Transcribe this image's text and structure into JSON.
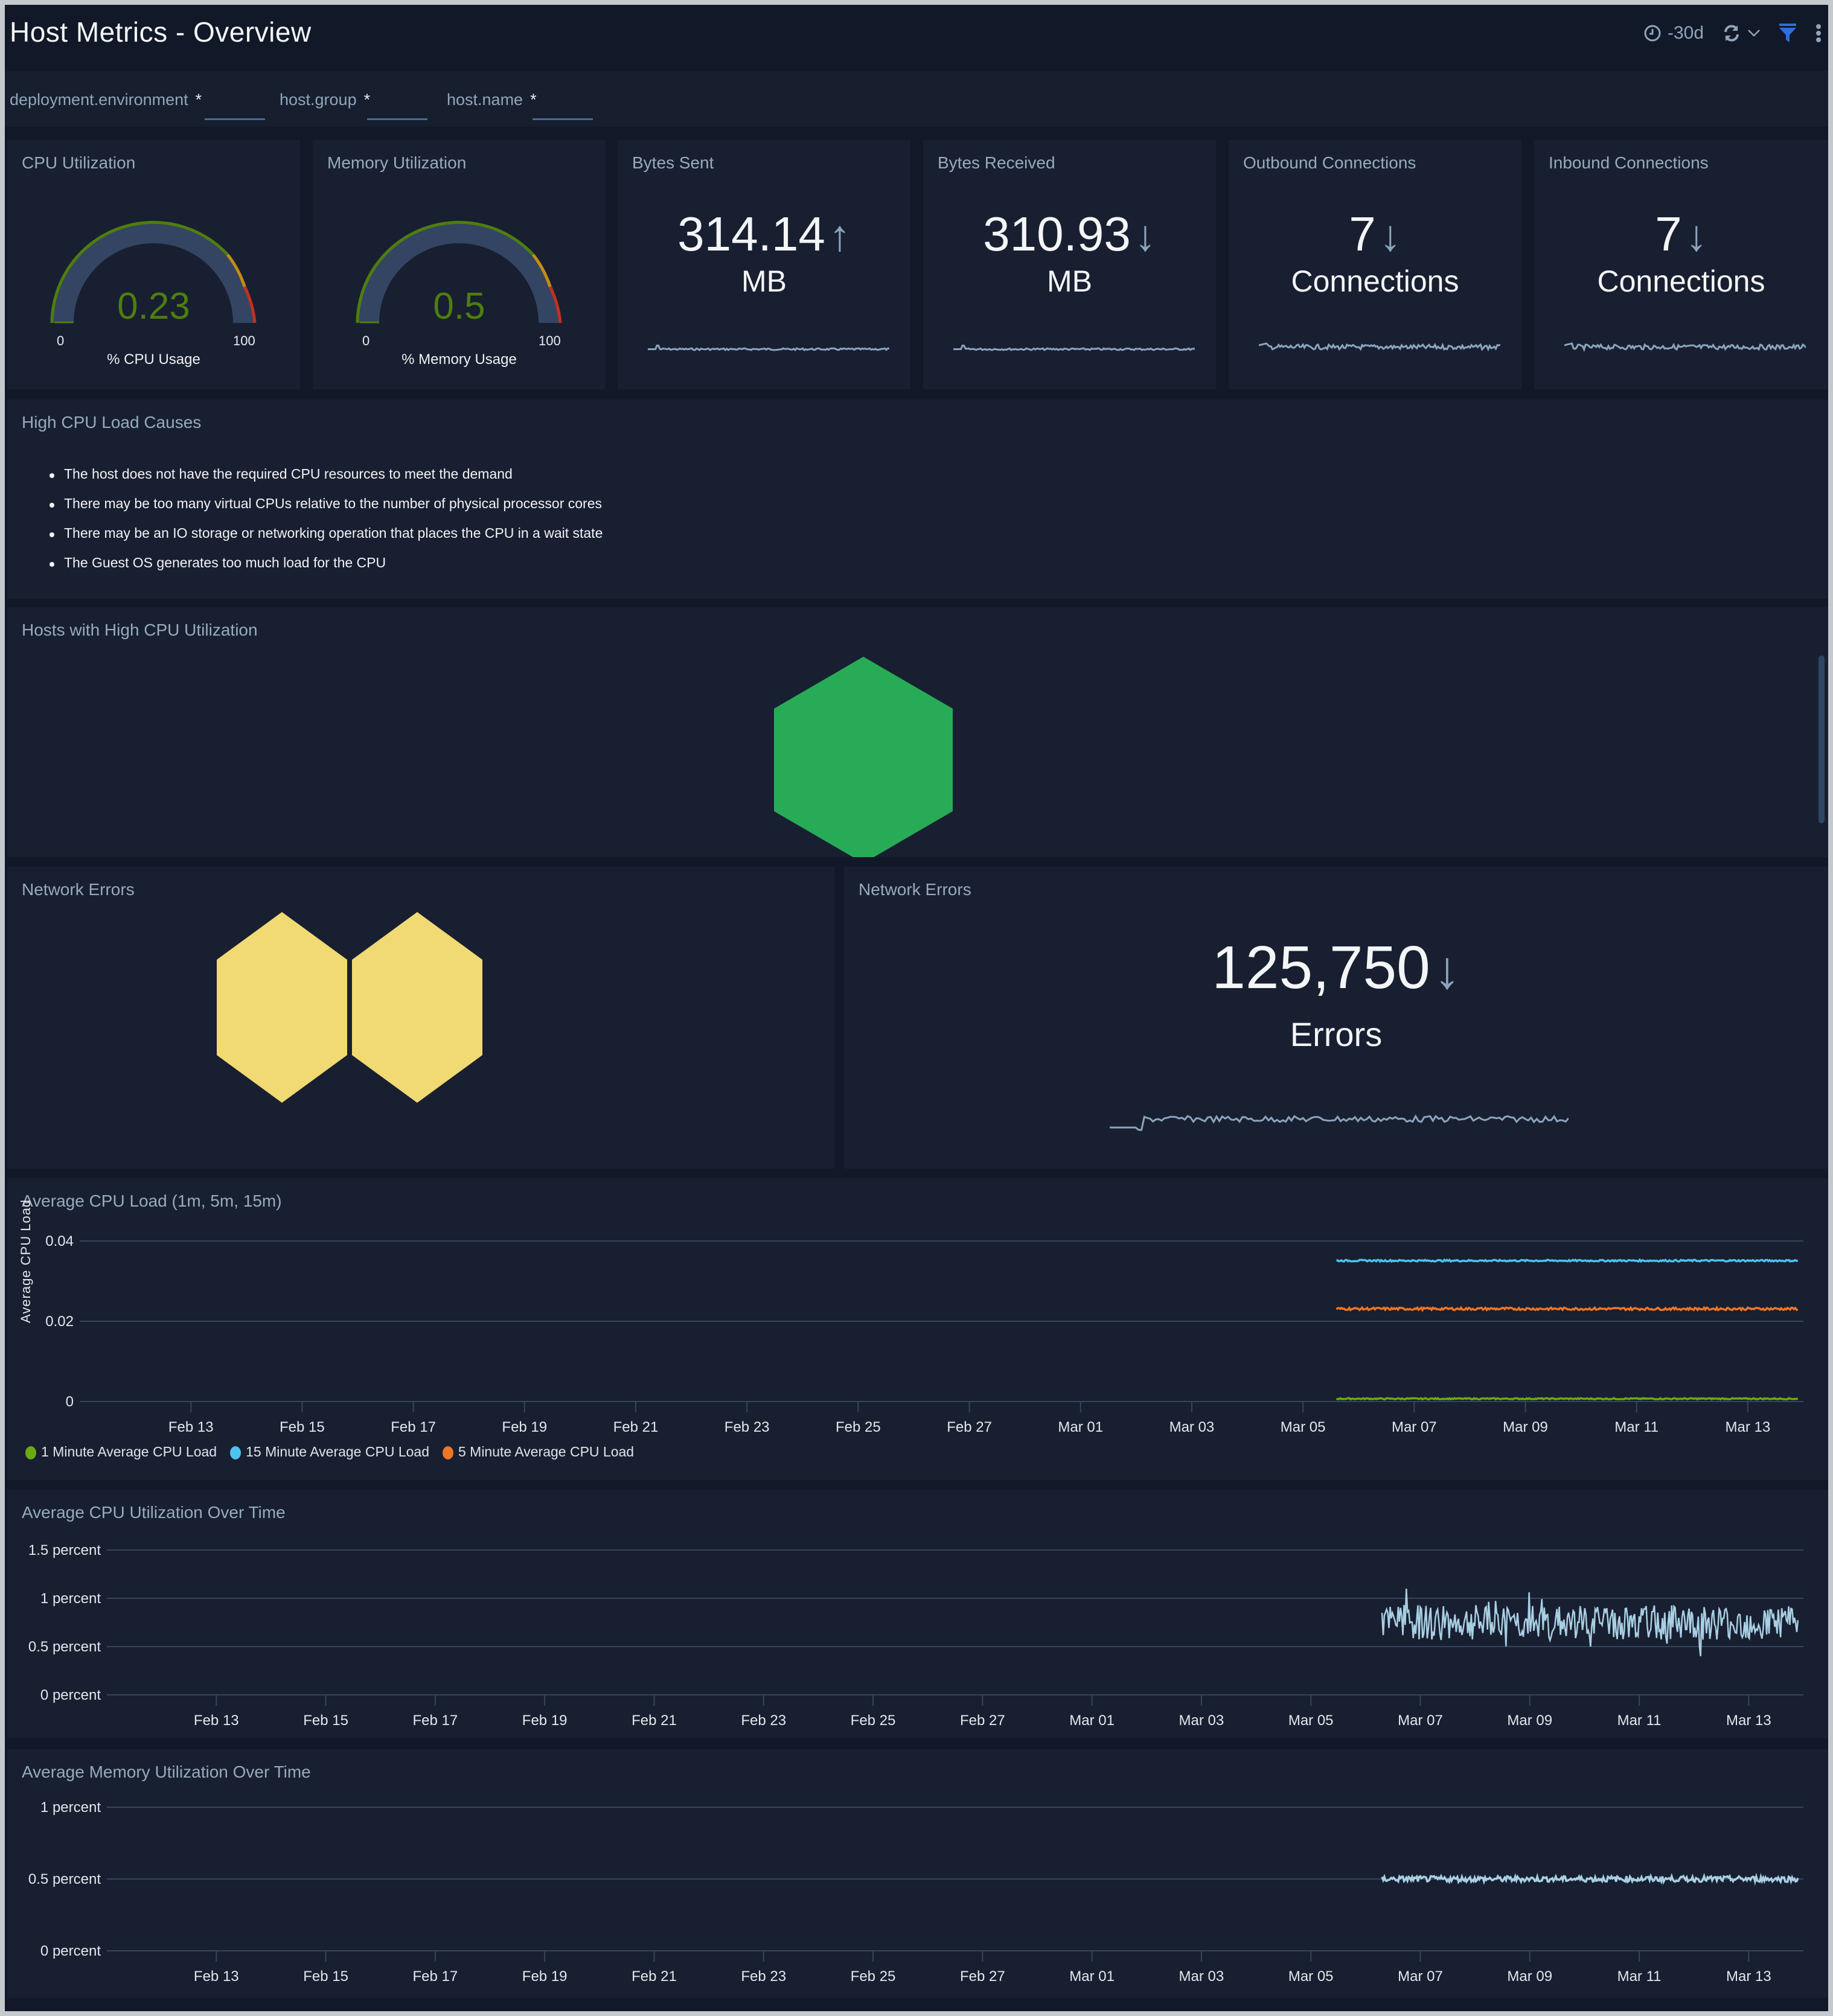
{
  "header": {
    "title": "Host Metrics - Overview",
    "time_range": "-30d",
    "icons": [
      "clock-icon",
      "refresh-icon",
      "chevron-down-icon",
      "filter-icon",
      "more-vertical-icon"
    ],
    "filter_icon_color": "#2e6fdb"
  },
  "filters": [
    {
      "label": "deployment.environment",
      "value": "*"
    },
    {
      "label": "host.group",
      "value": "*"
    },
    {
      "label": "host.name",
      "value": "*"
    }
  ],
  "gauges": [
    {
      "title": "CPU Utilization",
      "value": "0.23",
      "min": "0",
      "max": "100",
      "label": "% CPU Usage",
      "value_color": "#4e7d0e"
    },
    {
      "title": "Memory Utilization",
      "value": "0.5",
      "min": "0",
      "max": "100",
      "label": "% Memory Usage",
      "value_color": "#4e7d0e"
    }
  ],
  "stat_tiles": [
    {
      "title": "Bytes Sent",
      "value": "314.14",
      "trend": "up",
      "trend_glyph": "↑",
      "unit": "MB"
    },
    {
      "title": "Bytes Received",
      "value": "310.93",
      "trend": "down",
      "trend_glyph": "↓",
      "unit": "MB"
    },
    {
      "title": "Outbound Connections",
      "value": "7",
      "trend": "down",
      "trend_glyph": "↓",
      "unit": "Connections"
    },
    {
      "title": "Inbound Connections",
      "value": "7",
      "trend": "down",
      "trend_glyph": "↓",
      "unit": "Connections"
    }
  ],
  "causes": {
    "title": "High CPU Load Causes",
    "items": [
      "The host does not have the required CPU resources to meet the demand",
      "There may be too many virtual CPUs relative to the number of physical processor cores",
      "There may be an IO storage or networking operation that places the CPU in a wait state",
      "The Guest OS generates too much load for the CPU"
    ]
  },
  "hosts_panel": {
    "title": "Hosts with High CPU Utilization",
    "hexagons": [
      {
        "color": "#27ab57"
      }
    ]
  },
  "network_errors_honeycomb": {
    "title": "Network Errors",
    "hexagons": [
      {
        "color": "#f1d973"
      },
      {
        "color": "#f1d973"
      }
    ]
  },
  "network_errors_stat": {
    "title": "Network Errors",
    "value": "125,750",
    "trend": "down",
    "trend_glyph": "↓",
    "unit": "Errors"
  },
  "chart_data": [
    {
      "type": "line",
      "title": "Average CPU Load (1m, 5m, 15m)",
      "ylabel": "Average CPU Load",
      "xlabel": "",
      "x_ticks": [
        "Feb 13",
        "Feb 15",
        "Feb 17",
        "Feb 19",
        "Feb 21",
        "Feb 23",
        "Feb 25",
        "Feb 27",
        "Mar 01",
        "Mar 03",
        "Mar 05",
        "Mar 07",
        "Mar 09",
        "Mar 11",
        "Mar 13"
      ],
      "y_ticks": [
        "0",
        "0.02",
        "0.04"
      ],
      "ylim": [
        0,
        0.04
      ],
      "x_range_days": [
        -1,
        30
      ],
      "data_start_day": 21.6,
      "grid": true,
      "legend_position": "bottom-left",
      "series": [
        {
          "name": "1 Minute Average CPU Load",
          "color": "#6aaa14",
          "level": 0.0007,
          "noise": 0.00015
        },
        {
          "name": "15 Minute Average CPU Load",
          "color": "#4cc3ee",
          "level": 0.0351,
          "noise": 0.0002
        },
        {
          "name": "5 Minute Average CPU Load",
          "color": "#ec7526",
          "level": 0.0231,
          "noise": 0.0003
        }
      ]
    },
    {
      "type": "line",
      "title": "Average CPU Utilization Over Time",
      "ylabel": "",
      "xlabel": "",
      "x_ticks": [
        "Feb 13",
        "Feb 15",
        "Feb 17",
        "Feb 19",
        "Feb 21",
        "Feb 23",
        "Feb 25",
        "Feb 27",
        "Mar 01",
        "Mar 03",
        "Mar 05",
        "Mar 07",
        "Mar 09",
        "Mar 11",
        "Mar 13"
      ],
      "y_ticks": [
        "0 percent",
        "0.5 percent",
        "1 percent",
        "1.5 percent"
      ],
      "ylim": [
        0,
        1.5
      ],
      "x_range_days": [
        -1,
        30
      ],
      "data_start_day": 22.3,
      "grid": true,
      "series": [
        {
          "name": "Average CPU Utilization",
          "color": "#a9cfe4",
          "level": 0.75,
          "noise": 0.18,
          "max": 1.1,
          "min": 0.38
        }
      ]
    },
    {
      "type": "line",
      "title": "Average Memory Utilization Over Time",
      "ylabel": "",
      "xlabel": "",
      "x_ticks": [
        "Feb 13",
        "Feb 15",
        "Feb 17",
        "Feb 19",
        "Feb 21",
        "Feb 23",
        "Feb 25",
        "Feb 27",
        "Mar 01",
        "Mar 03",
        "Mar 05",
        "Mar 07",
        "Mar 09",
        "Mar 11",
        "Mar 13"
      ],
      "y_ticks": [
        "0 percent",
        "0.5 percent",
        "1 percent"
      ],
      "ylim": [
        0,
        1
      ],
      "x_range_days": [
        -1,
        30
      ],
      "data_start_day": 22.3,
      "grid": true,
      "series": [
        {
          "name": "Average Memory Utilization",
          "color": "#a9cfe4",
          "level": 0.5,
          "noise": 0.02
        }
      ]
    }
  ]
}
